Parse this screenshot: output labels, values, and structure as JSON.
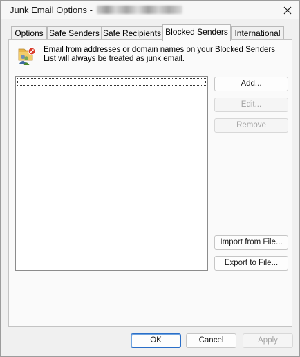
{
  "window": {
    "title_prefix": "Junk Email Options - ",
    "title_account": "b▒▒▒▒▒▒▒▒▒▒▒▒▒▒▒▒▒▒"
  },
  "tabs": [
    {
      "label": "Options"
    },
    {
      "label": "Safe Senders"
    },
    {
      "label": "Safe Recipients"
    },
    {
      "label": "Blocked Senders",
      "active": true
    },
    {
      "label": "International"
    }
  ],
  "panel": {
    "info_text": "Email from addresses or domain names on your Blocked Senders List will always be treated as junk email.",
    "list_items": []
  },
  "buttons": {
    "add": "Add...",
    "edit": "Edit...",
    "remove": "Remove",
    "import": "Import from File...",
    "export": "Export to File..."
  },
  "footer": {
    "ok": "OK",
    "cancel": "Cancel",
    "apply": "Apply"
  },
  "colors": {
    "accent_default_button": "#2a6ec8",
    "disabled_text": "#a3a3a3",
    "blocked_badge": "#d93a2b"
  }
}
